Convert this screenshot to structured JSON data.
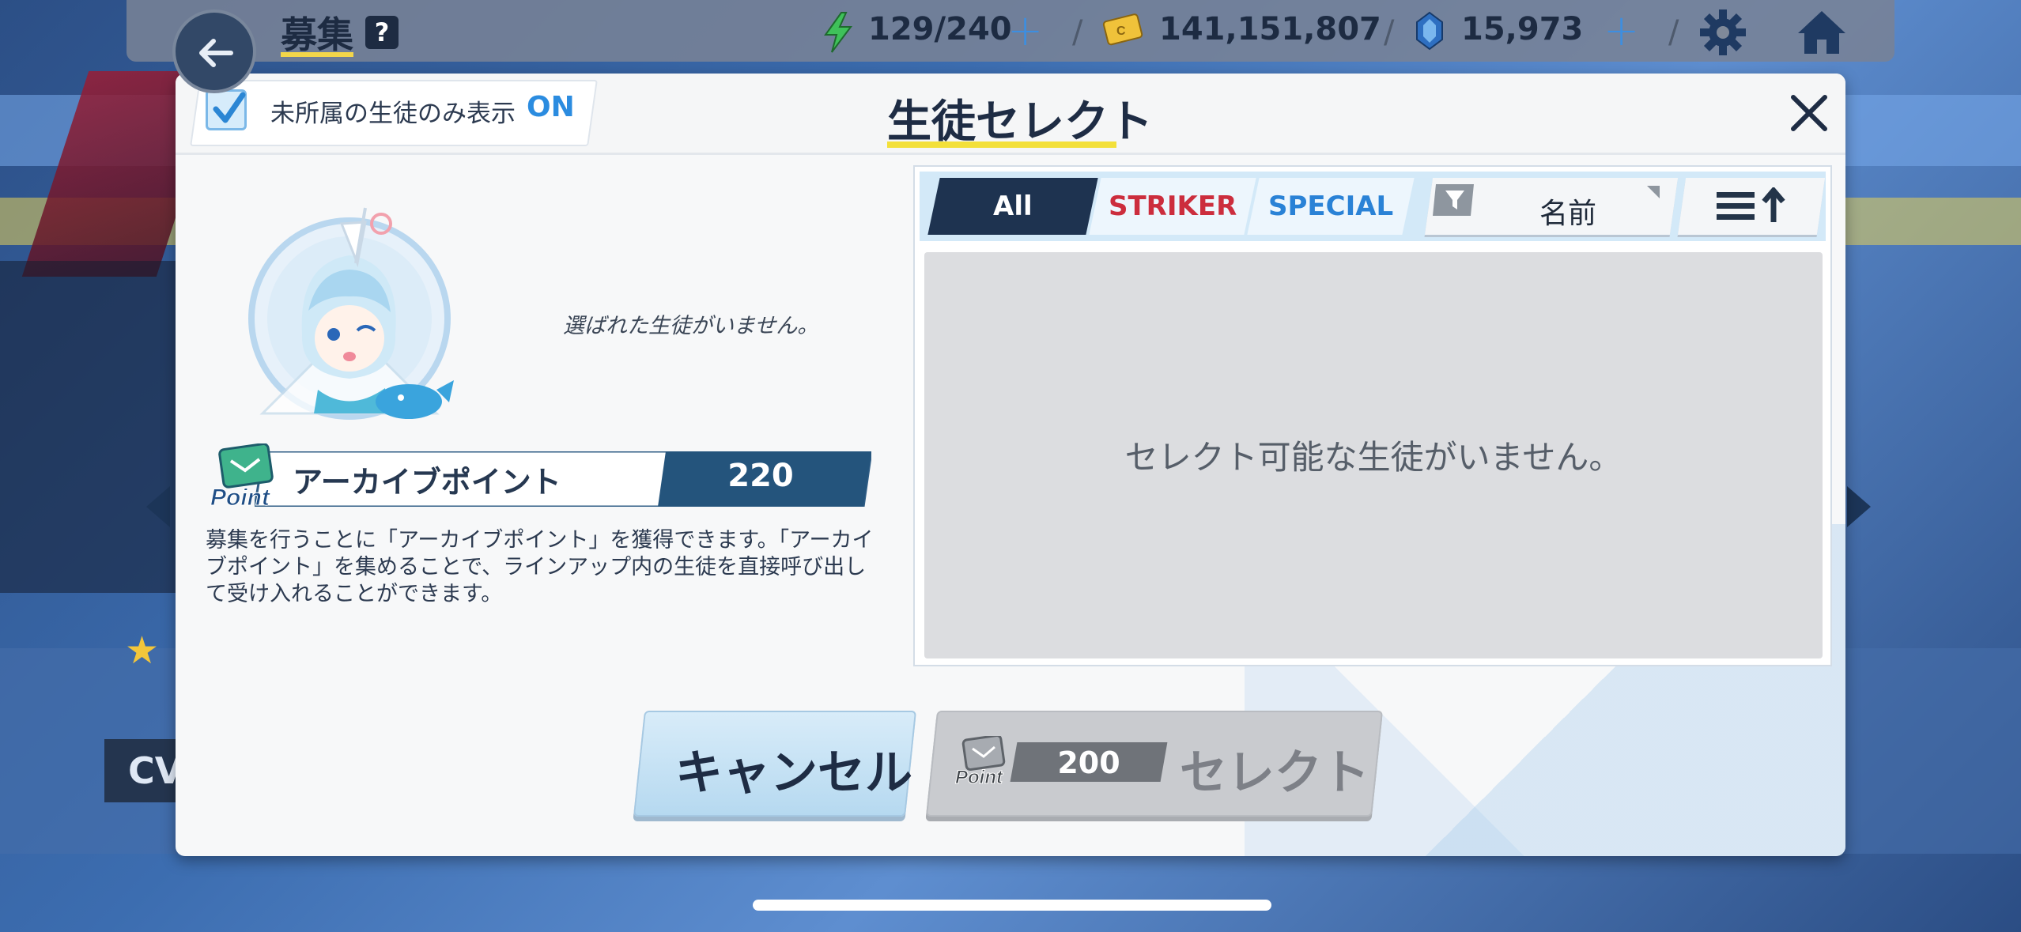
{
  "topbar": {
    "title": "募集",
    "help_label": "?",
    "ap": "129/240",
    "credits": "141,151,807",
    "gems": "15,973"
  },
  "dialog": {
    "filter_label": "未所属の生徒のみ表示",
    "filter_state": "ON",
    "title": "生徒セレクト",
    "no_selection_text": "選ばれた生徒がいません。",
    "archive_points": {
      "icon_text": "Point",
      "label": "アーカイブポイント",
      "value": "220",
      "description": "募集を行うことに「アーカイブポイント」を獲得できます。「アーカイブポイント」を集めることで、ラインアップ内の生徒を直接呼び出して受け入れることができます。"
    },
    "tabs": [
      {
        "label": "All",
        "active": true
      },
      {
        "label": "STRIKER",
        "active": false
      },
      {
        "label": "SPECIAL",
        "active": false
      }
    ],
    "sort_label": "名前",
    "empty_message": "セレクト可能な生徒がいません。",
    "cancel_label": "キャンセル",
    "select": {
      "icon_text": "Point",
      "cost": "200",
      "label": "セレクト"
    }
  },
  "background": {
    "cv_label": "CV"
  },
  "colors": {
    "accent_blue": "#2b8ce0",
    "dark_navy": "#1e3350",
    "striker_red": "#cc2d3d",
    "special_blue": "#2a82d6",
    "title_underline": "#f3e03a"
  }
}
